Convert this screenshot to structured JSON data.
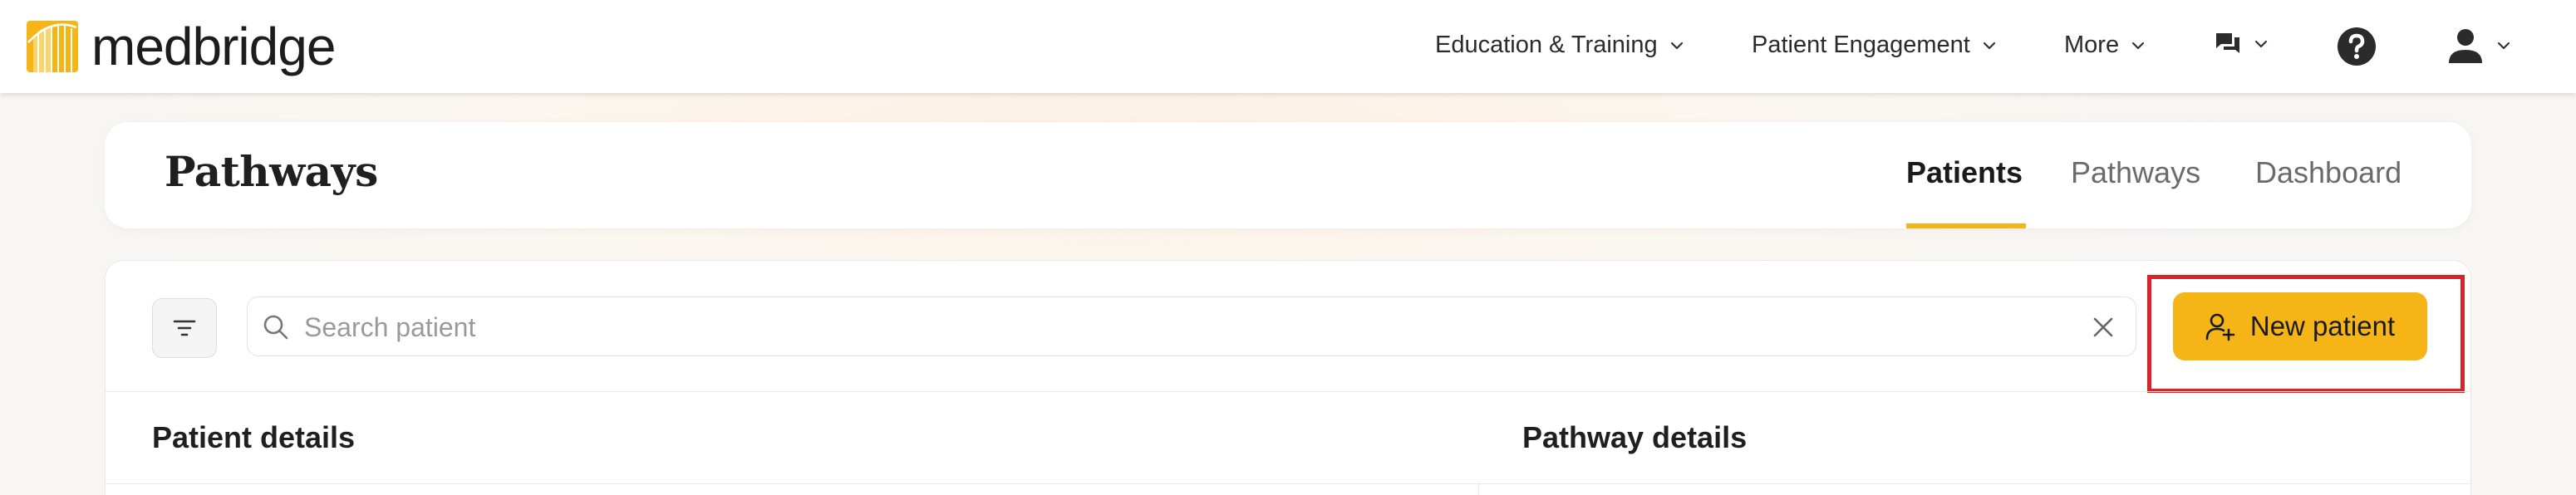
{
  "brand": {
    "name": "medbridge",
    "accent": "#f6b516"
  },
  "nav": {
    "items": [
      {
        "label": "Education & Training",
        "icon": "chevron-down-icon"
      },
      {
        "label": "Patient Engagement",
        "icon": "chevron-down-icon"
      },
      {
        "label": "More",
        "icon": "chevron-down-icon"
      }
    ],
    "icons": [
      "chat-icon",
      "help-icon",
      "user-icon"
    ]
  },
  "header": {
    "title": "Pathways",
    "tabs": [
      {
        "label": "Patients",
        "active": true
      },
      {
        "label": "Pathways",
        "active": false
      },
      {
        "label": "Dashboard",
        "active": false
      }
    ]
  },
  "search": {
    "placeholder": "Search patient",
    "value": ""
  },
  "toolbar": {
    "new_patient_label": "New patient"
  },
  "table": {
    "columns": [
      "Patient details",
      "Pathway details"
    ]
  },
  "colors": {
    "highlight": "#d9232a",
    "accent": "#f6b516"
  }
}
